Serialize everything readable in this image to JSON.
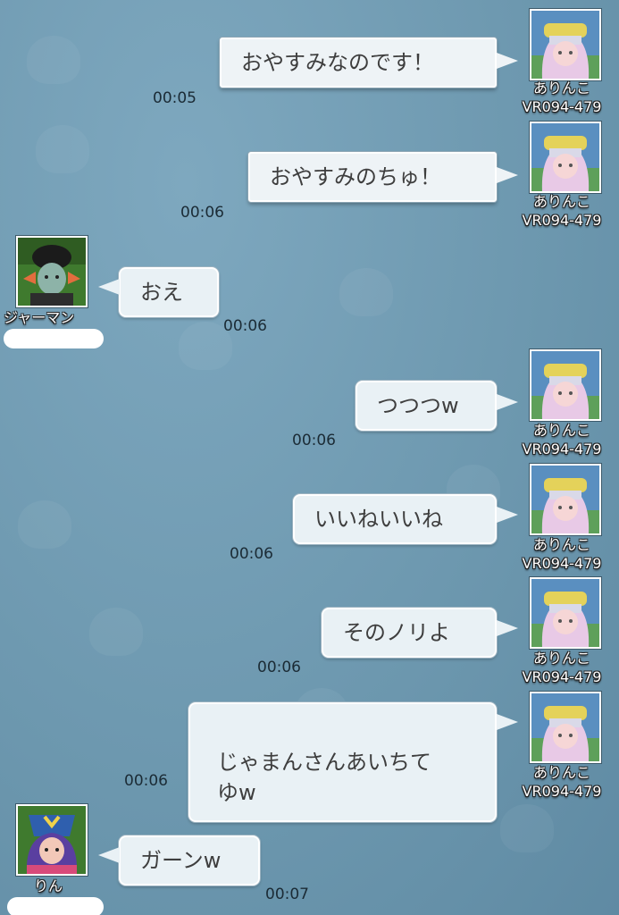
{
  "messages": [
    {
      "side": "right",
      "text": "おやすみなのです！",
      "time": "00:05",
      "name": "ありんこ",
      "id": "VR094-479"
    },
    {
      "side": "right",
      "text": "おやすみのちゅ！",
      "time": "00:06",
      "name": "ありんこ",
      "id": "VR094-479"
    },
    {
      "side": "left",
      "text": "おえ",
      "time": "00:06",
      "name": "ジャーマン"
    },
    {
      "side": "right",
      "text": "つつつw",
      "time": "00:06",
      "name": "ありんこ",
      "id": "VR094-479"
    },
    {
      "side": "right",
      "text": "いいねいいね",
      "time": "00:06",
      "name": "ありんこ",
      "id": "VR094-479"
    },
    {
      "side": "right",
      "text": "そのノリよ",
      "time": "00:06",
      "name": "ありんこ",
      "id": "VR094-479"
    },
    {
      "side": "right",
      "text": "じゃまんさんあいちて\nゆw",
      "time": "00:06",
      "name": "ありんこ",
      "id": "VR094-479"
    },
    {
      "side": "left",
      "text": "ガーンw",
      "time": "00:07",
      "name": "りん"
    }
  ],
  "icons": {
    "avatar_arinko": "character-avatar-icon",
    "avatar_german": "character-avatar-icon",
    "avatar_rin": "character-avatar-icon"
  }
}
